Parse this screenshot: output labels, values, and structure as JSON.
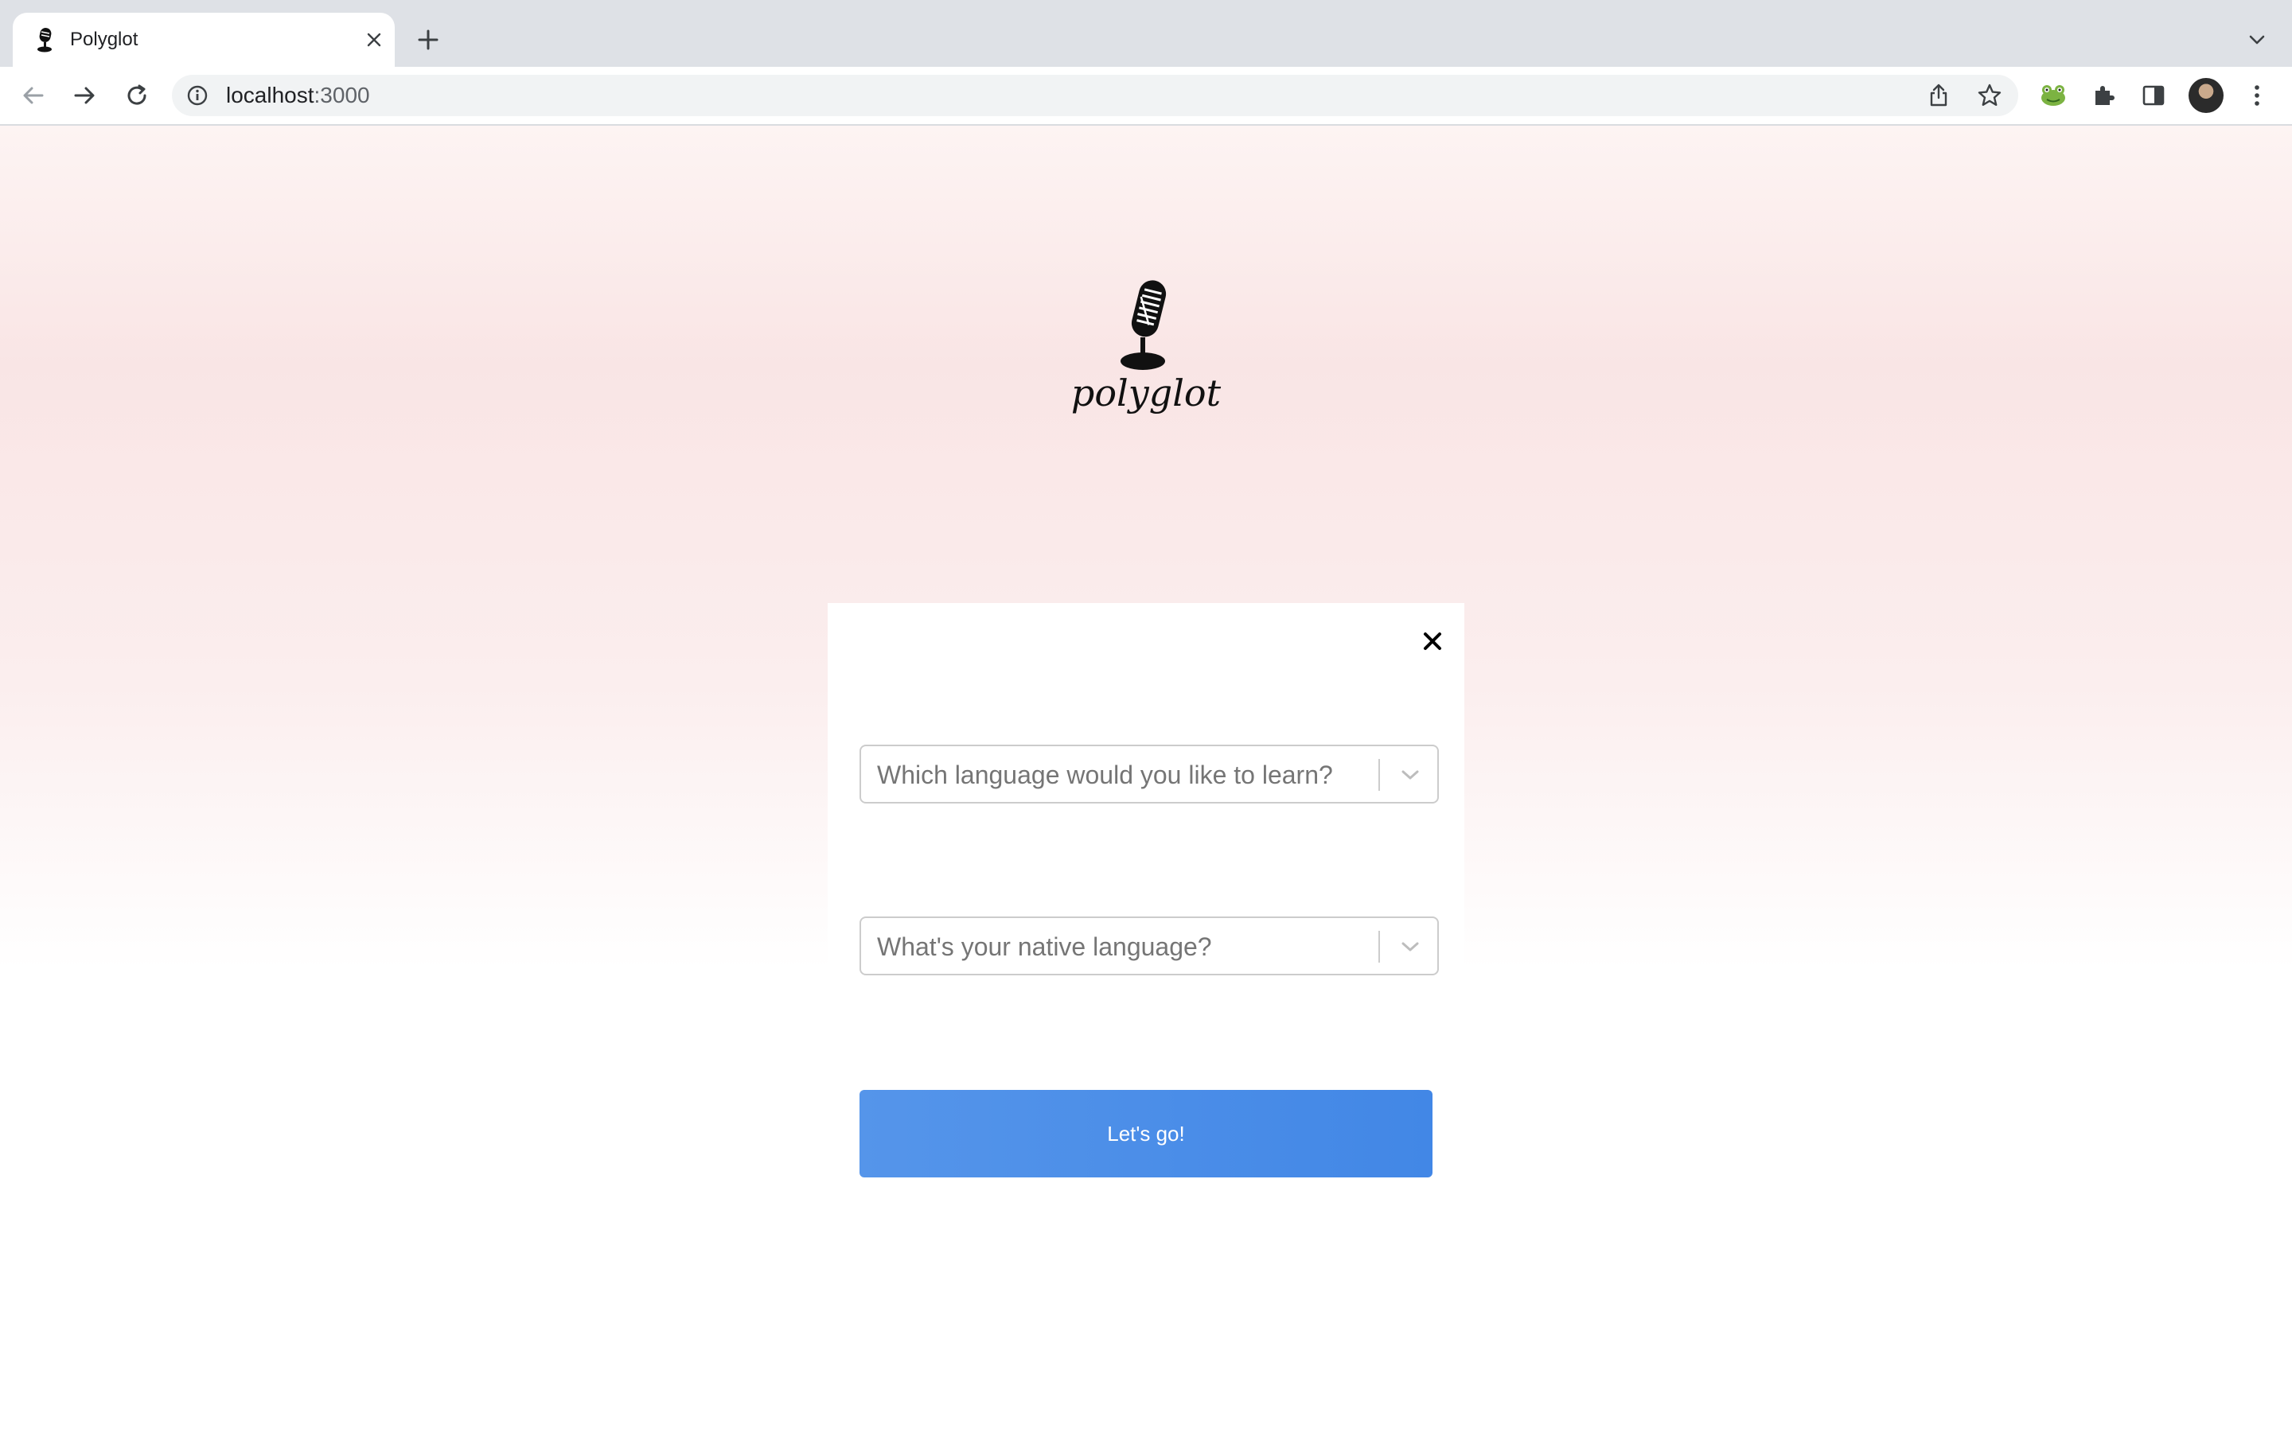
{
  "browser": {
    "tab": {
      "title": "Polyglot",
      "favicon": "microphone-icon"
    },
    "address_bar": {
      "host": "localhost",
      "port": ":3000"
    },
    "icons": {
      "back": "arrow-left-icon",
      "forward": "arrow-right-icon",
      "reload": "reload-icon",
      "site_info": "info-icon",
      "share": "share-icon",
      "bookmark": "star-icon",
      "extension": "frog-extension-icon",
      "extensions_menu": "puzzle-icon",
      "side_panel": "side-panel-icon",
      "menu": "kebab-menu-icon"
    }
  },
  "app": {
    "brand": "polyglot",
    "logo_icon": "microphone-icon",
    "form": {
      "learn_language_placeholder": "Which language would you like to learn?",
      "native_language_placeholder": "What's your native language?",
      "submit_label": "Let's go!"
    }
  },
  "colors": {
    "primary_button": "#4a8fe8",
    "page_gradient_top": "#fdf4f3",
    "page_gradient_mid": "#f9e5e5",
    "tab_strip": "#dee1e6"
  }
}
